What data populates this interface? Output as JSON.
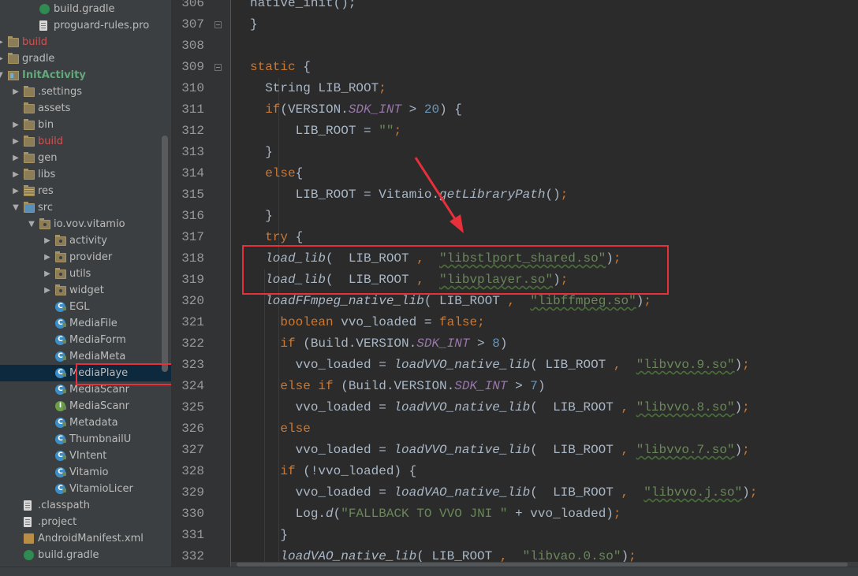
{
  "tree": {
    "rows": [
      {
        "label": "build.gradle",
        "icon": "gradle-icon",
        "arrow": "",
        "color": ""
      },
      {
        "label": "proguard-rules.pro",
        "icon": "file-icon",
        "arrow": "",
        "color": ""
      },
      {
        "label": "build",
        "icon": "folder-icon",
        "arrow": "▶",
        "color": "red"
      },
      {
        "label": "gradle",
        "icon": "folder-icon",
        "arrow": "▶",
        "color": ""
      },
      {
        "label": "InitActivity",
        "icon": "module-icon",
        "arrow": "▼",
        "color": "green-bold"
      },
      {
        "label": ".settings",
        "icon": "folder-icon",
        "arrow": "▶",
        "color": ""
      },
      {
        "label": "assets",
        "icon": "folder-icon",
        "arrow": "",
        "color": ""
      },
      {
        "label": "bin",
        "icon": "folder-icon",
        "arrow": "▶",
        "color": ""
      },
      {
        "label": "build",
        "icon": "folder-icon",
        "arrow": "▶",
        "color": "red"
      },
      {
        "label": "gen",
        "icon": "folder-icon",
        "arrow": "▶",
        "color": ""
      },
      {
        "label": "libs",
        "icon": "folder-icon",
        "arrow": "▶",
        "color": ""
      },
      {
        "label": "res",
        "icon": "res-folder-icon",
        "arrow": "▶",
        "color": ""
      },
      {
        "label": "src",
        "icon": "src-folder-icon",
        "arrow": "▼",
        "color": ""
      },
      {
        "label": "io.vov.vitamio",
        "icon": "package-icon",
        "arrow": "▼",
        "color": ""
      },
      {
        "label": "activity",
        "icon": "package-icon",
        "arrow": "▶",
        "color": ""
      },
      {
        "label": "provider",
        "icon": "package-icon",
        "arrow": "▶",
        "color": ""
      },
      {
        "label": "utils",
        "icon": "package-icon",
        "arrow": "▶",
        "color": ""
      },
      {
        "label": "widget",
        "icon": "package-icon",
        "arrow": "▶",
        "color": ""
      },
      {
        "label": "EGL",
        "icon": "class-icon",
        "arrow": "",
        "color": ""
      },
      {
        "label": "MediaFile",
        "icon": "class-icon",
        "arrow": "",
        "color": ""
      },
      {
        "label": "MediaForm",
        "icon": "class-icon",
        "arrow": "",
        "color": ""
      },
      {
        "label": "MediaMeta",
        "icon": "class-icon",
        "arrow": "",
        "color": ""
      },
      {
        "label": "MediaPlaye",
        "icon": "class-icon",
        "arrow": "",
        "color": "",
        "selected": true
      },
      {
        "label": "MediaScanr",
        "icon": "class-icon",
        "arrow": "",
        "color": ""
      },
      {
        "label": "MediaScanr",
        "icon": "interface-icon",
        "arrow": "",
        "color": ""
      },
      {
        "label": "Metadata",
        "icon": "class-icon",
        "arrow": "",
        "color": ""
      },
      {
        "label": "ThumbnailU",
        "icon": "class-icon",
        "arrow": "",
        "color": ""
      },
      {
        "label": "VIntent",
        "icon": "class-icon",
        "arrow": "",
        "color": ""
      },
      {
        "label": "Vitamio",
        "icon": "class-icon",
        "arrow": "",
        "color": ""
      },
      {
        "label": "VitamioLicer",
        "icon": "class-icon",
        "arrow": "",
        "color": ""
      },
      {
        "label": ".classpath",
        "icon": "file-icon",
        "arrow": "",
        "color": ""
      },
      {
        "label": ".project",
        "icon": "file-icon",
        "arrow": "",
        "color": ""
      },
      {
        "label": "AndroidManifest.xml",
        "icon": "xml-icon",
        "arrow": "",
        "color": ""
      },
      {
        "label": "build.gradle",
        "icon": "gradle-icon",
        "arrow": "",
        "color": ""
      }
    ]
  },
  "editor": {
    "line_numbers": [
      "306",
      "307",
      "308",
      "309",
      "310",
      "311",
      "312",
      "313",
      "314",
      "315",
      "316",
      "317",
      "318",
      "319",
      "320",
      "321",
      "322",
      "323",
      "324",
      "325",
      "326",
      "327",
      "328",
      "329",
      "330",
      "331",
      "332"
    ],
    "code": [
      [
        {
          "t": "native_init();",
          "c": "p"
        }
      ],
      [
        {
          "t": "}",
          "c": "p"
        }
      ],
      [],
      [
        {
          "t": "static",
          "c": "kw"
        },
        {
          "t": " {",
          "c": "p"
        }
      ],
      [
        {
          "t": "  String LIB_ROOT",
          "c": "p"
        },
        {
          "t": ";",
          "c": "kw"
        }
      ],
      [
        {
          "t": "  ",
          "c": "p"
        },
        {
          "t": "if",
          "c": "kw"
        },
        {
          "t": "(VERSION.",
          "c": "p"
        },
        {
          "t": "SDK_INT",
          "c": "stat"
        },
        {
          "t": " > ",
          "c": "p"
        },
        {
          "t": "20",
          "c": "num"
        },
        {
          "t": ") {",
          "c": "p"
        }
      ],
      [
        {
          "t": "      LIB_ROOT = ",
          "c": "p"
        },
        {
          "t": "\"\"",
          "c": "str"
        },
        {
          "t": ";",
          "c": "kw"
        }
      ],
      [
        {
          "t": "  }",
          "c": "p"
        }
      ],
      [
        {
          "t": "  ",
          "c": "p"
        },
        {
          "t": "else",
          "c": "kw"
        },
        {
          "t": "{",
          "c": "p"
        }
      ],
      [
        {
          "t": "      LIB_ROOT = Vitamio.",
          "c": "p"
        },
        {
          "t": "getLibraryPath",
          "c": "callit"
        },
        {
          "t": "()",
          "c": "p"
        },
        {
          "t": ";",
          "c": "kw"
        }
      ],
      [
        {
          "t": "  }",
          "c": "p"
        }
      ],
      [
        {
          "t": "  ",
          "c": "p"
        },
        {
          "t": "try",
          "c": "kw"
        },
        {
          "t": " {",
          "c": "p"
        }
      ],
      [
        {
          "t": "  ",
          "c": "p"
        },
        {
          "t": "load_lib",
          "c": "callit"
        },
        {
          "t": "(  LIB_ROOT ",
          "c": "p"
        },
        {
          "t": ",",
          "c": "kw"
        },
        {
          "t": "  ",
          "c": "p"
        },
        {
          "t": "\"libstlport_shared.so\"",
          "c": "strsq"
        },
        {
          "t": ")",
          "c": "p"
        },
        {
          "t": ";",
          "c": "kw"
        }
      ],
      [
        {
          "t": "  ",
          "c": "p"
        },
        {
          "t": "load_lib",
          "c": "callit"
        },
        {
          "t": "(  LIB_ROOT ",
          "c": "p"
        },
        {
          "t": ",",
          "c": "kw"
        },
        {
          "t": "  ",
          "c": "p"
        },
        {
          "t": "\"libvplayer.so\"",
          "c": "strsq"
        },
        {
          "t": ")",
          "c": "p"
        },
        {
          "t": ";",
          "c": "kw"
        }
      ],
      [
        {
          "t": "  ",
          "c": "p"
        },
        {
          "t": "loadFFmpeg_native_lib",
          "c": "callit"
        },
        {
          "t": "( LIB_ROOT ",
          "c": "p"
        },
        {
          "t": ",",
          "c": "kw"
        },
        {
          "t": "  ",
          "c": "p"
        },
        {
          "t": "\"libffmpeg.so\"",
          "c": "strsq"
        },
        {
          "t": ")",
          "c": "p"
        },
        {
          "t": ";",
          "c": "kw"
        }
      ],
      [
        {
          "t": "    ",
          "c": "p"
        },
        {
          "t": "boolean",
          "c": "kw"
        },
        {
          "t": " vvo_loaded = ",
          "c": "p"
        },
        {
          "t": "false",
          "c": "kw"
        },
        {
          "t": ";",
          "c": "kw"
        }
      ],
      [
        {
          "t": "    ",
          "c": "p"
        },
        {
          "t": "if",
          "c": "kw"
        },
        {
          "t": " (Build.VERSION.",
          "c": "p"
        },
        {
          "t": "SDK_INT",
          "c": "stat"
        },
        {
          "t": " > ",
          "c": "p"
        },
        {
          "t": "8",
          "c": "num"
        },
        {
          "t": ")",
          "c": "p"
        }
      ],
      [
        {
          "t": "      vvo_loaded = ",
          "c": "p"
        },
        {
          "t": "loadVVO_native_lib",
          "c": "callit"
        },
        {
          "t": "( LIB_ROOT ",
          "c": "p"
        },
        {
          "t": ",",
          "c": "kw"
        },
        {
          "t": "  ",
          "c": "p"
        },
        {
          "t": "\"libvvo.9.so\"",
          "c": "strsq"
        },
        {
          "t": ")",
          "c": "p"
        },
        {
          "t": ";",
          "c": "kw"
        }
      ],
      [
        {
          "t": "    ",
          "c": "p"
        },
        {
          "t": "else if",
          "c": "kw"
        },
        {
          "t": " (Build.VERSION.",
          "c": "p"
        },
        {
          "t": "SDK_INT",
          "c": "stat"
        },
        {
          "t": " > ",
          "c": "p"
        },
        {
          "t": "7",
          "c": "num"
        },
        {
          "t": ")",
          "c": "p"
        }
      ],
      [
        {
          "t": "      vvo_loaded = ",
          "c": "p"
        },
        {
          "t": "loadVVO_native_lib",
          "c": "callit"
        },
        {
          "t": "(  LIB_ROOT ",
          "c": "p"
        },
        {
          "t": ",",
          "c": "kw"
        },
        {
          "t": " ",
          "c": "p"
        },
        {
          "t": "\"libvvo.8.so\"",
          "c": "strsq"
        },
        {
          "t": ")",
          "c": "p"
        },
        {
          "t": ";",
          "c": "kw"
        }
      ],
      [
        {
          "t": "    ",
          "c": "p"
        },
        {
          "t": "else",
          "c": "kw"
        }
      ],
      [
        {
          "t": "      vvo_loaded = ",
          "c": "p"
        },
        {
          "t": "loadVVO_native_lib",
          "c": "callit"
        },
        {
          "t": "(  LIB_ROOT ",
          "c": "p"
        },
        {
          "t": ",",
          "c": "kw"
        },
        {
          "t": " ",
          "c": "p"
        },
        {
          "t": "\"libvvo.7.so\"",
          "c": "strsq"
        },
        {
          "t": ")",
          "c": "p"
        },
        {
          "t": ";",
          "c": "kw"
        }
      ],
      [
        {
          "t": "    ",
          "c": "p"
        },
        {
          "t": "if",
          "c": "kw"
        },
        {
          "t": " (!vvo_loaded) {",
          "c": "p"
        }
      ],
      [
        {
          "t": "      vvo_loaded = ",
          "c": "p"
        },
        {
          "t": "loadVAO_native_lib",
          "c": "callit"
        },
        {
          "t": "(  LIB_ROOT ",
          "c": "p"
        },
        {
          "t": ",",
          "c": "kw"
        },
        {
          "t": "  ",
          "c": "p"
        },
        {
          "t": "\"libvvo.j.so\"",
          "c": "strsq"
        },
        {
          "t": ")",
          "c": "p"
        },
        {
          "t": ";",
          "c": "kw"
        }
      ],
      [
        {
          "t": "      Log.",
          "c": "p"
        },
        {
          "t": "d",
          "c": "callit"
        },
        {
          "t": "(",
          "c": "p"
        },
        {
          "t": "\"FALLBACK TO VVO JNI \"",
          "c": "str"
        },
        {
          "t": " + vvo_loaded)",
          "c": "p"
        },
        {
          "t": ";",
          "c": "kw"
        }
      ],
      [
        {
          "t": "    }",
          "c": "p"
        }
      ],
      [
        {
          "t": "    ",
          "c": "p"
        },
        {
          "t": "loadVAO_native_lib",
          "c": "callit"
        },
        {
          "t": "( LIB_ROOT ",
          "c": "p"
        },
        {
          "t": ",",
          "c": "kw"
        },
        {
          "t": "  ",
          "c": "p"
        },
        {
          "t": "\"libvao.0.so\"",
          "c": "strsq"
        },
        {
          "t": ")",
          "c": "p"
        },
        {
          "t": ";",
          "c": "kw"
        }
      ]
    ]
  },
  "colors": {
    "annotation_red": "#e8303a",
    "keyword": "#cc7832",
    "string": "#6a8759",
    "number": "#6897bb",
    "static_field": "#9876aa",
    "plain": "#a9b7c6"
  }
}
